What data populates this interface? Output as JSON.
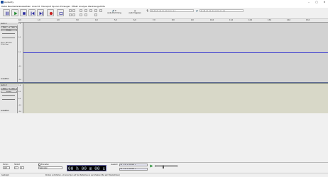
{
  "window": {
    "title": "Audacity"
  },
  "menu": [
    "Datei",
    "Bearbeiten",
    "Auswählen",
    "Ansicht",
    "Transport",
    "Spuren",
    "Erzeugen",
    "Effekt",
    "Analyse",
    "Werkzeuge",
    "Hilfe"
  ],
  "toolbar": {
    "rate_label": "Audio-Einrichtung",
    "share_label": "Audio freigeben",
    "rate_value": "Teilen"
  },
  "meter": {
    "scale_rec": "-54 -48 -42 -36 -30 -24 -18 -12 -6 0",
    "scale_play": "-54 -48 -42 -36 -30 -24 -18 -12 -6 0"
  },
  "ruler": {
    "ticks": [
      "0,0",
      "1,0",
      "2,0",
      "3,0",
      "4,0",
      "5,0",
      "6,0",
      "7,0",
      "8,0",
      "9,0",
      "10,0",
      "11,0",
      "12,0",
      "13,0",
      "14,0",
      "15,0"
    ]
  },
  "tracks": [
    {
      "name": "Audio 1",
      "mute": "Mute",
      "solo": "Solo",
      "effects": "Effekte",
      "info": "Mono, 44100Hz\n32-bit float",
      "select": "Auswählen",
      "scale": [
        "1,0",
        "0,5",
        "0,0",
        "-0,5",
        "-1,0"
      ]
    },
    {
      "name": "Audio 2",
      "mute": "Mute",
      "solo": "Solo",
      "effects": "Effekte",
      "select": "Auswählen",
      "scale": [
        "1,0",
        "0,5",
        "0,0",
        "-0,5",
        "-1,0"
      ]
    }
  ],
  "bottom": {
    "project_rate_label": "Tempo",
    "snap_label": "Einrasten",
    "time_sig_label": "Taktart",
    "tempo_value": "120",
    "timesig_value": "4",
    "timesig_denom": "4",
    "snap_value": "Sekunden",
    "time": "00 h 00 m 00 s",
    "selection_label": "Auswahl",
    "sel_start": "00 h 00 m 00,000 s",
    "sel_end": "00 h 00 m 00,000 s"
  },
  "status": {
    "left": "Gestoppt.",
    "hint": "Klicken und Ziehen, um eine Spur auf der Zeitachse zu verschieben (Bei sehr Wiederholen)"
  }
}
